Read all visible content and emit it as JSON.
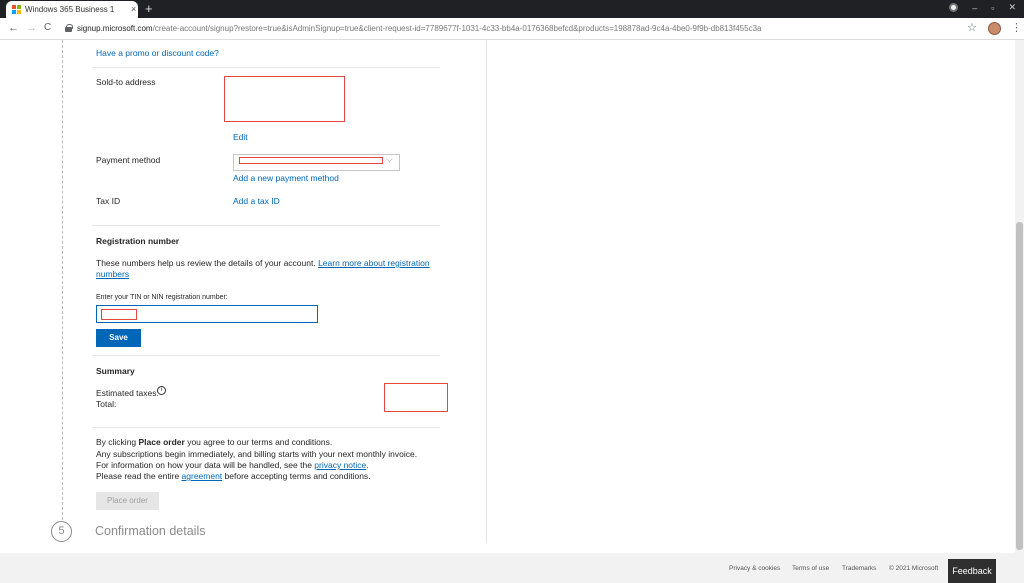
{
  "browser": {
    "tab_title": "Windows 365 Business 1",
    "tab_close": "×",
    "new_tab": "+",
    "url_host": "signup.microsoft.com",
    "url_path": "/create-account/signup?restore=true&isAdminSignup=true&client-request-id=7789677f-1031-4c33-bb4a-0176368befcd&products=198878ad-9c4a-4be0-9f9b-db813f455c3a",
    "back": "←",
    "forward": "→",
    "reload": "C",
    "star": "☆",
    "menu": "⋮",
    "minimize": "–",
    "restore": "▫",
    "close": "✕"
  },
  "form": {
    "promo_link": "Have a promo or discount code?",
    "sold_to_label": "Sold-to address",
    "edit_link": "Edit",
    "payment_label": "Payment method",
    "add_payment_link": "Add a new payment method",
    "tax_id_label": "Tax ID",
    "add_tax_link": "Add a tax ID"
  },
  "registration": {
    "heading": "Registration number",
    "help_text": "These numbers help us review the details of your account.",
    "learn_more_1": "Learn more about registration",
    "learn_more_2": "numbers",
    "input_label": "Enter your TIN or NIN registration number:",
    "save_label": "Save"
  },
  "summary": {
    "heading": "Summary",
    "estimated_taxes": "Estimated taxes:",
    "info_icon": "i",
    "total": "Total:"
  },
  "terms": {
    "line1_prefix": "By clicking ",
    "line1_bold": "Place order",
    "line1_suffix": " you agree to our terms and conditions.",
    "line2": "Any subscriptions begin immediately, and billing starts with your next monthly invoice.",
    "line3_prefix": "For information on how your data will be handled, see the ",
    "line3_link": "privacy notice",
    "line3_suffix": ".",
    "line4_prefix": "Please read the entire ",
    "line4_link": "agreement",
    "line4_suffix": " before accepting terms and conditions.",
    "place_order_label": "Place order"
  },
  "steps": {
    "step5_number": "5",
    "step5_label": "Confirmation details"
  },
  "footer": {
    "privacy": "Privacy & cookies",
    "terms_of_use": "Terms of use",
    "trademarks": "Trademarks",
    "copyright": "© 2021 Microsoft",
    "feedback": "Feedback"
  },
  "colors": {
    "link": "#0067b8",
    "primary_button": "#0067b8",
    "redaction": "#e8473d"
  }
}
